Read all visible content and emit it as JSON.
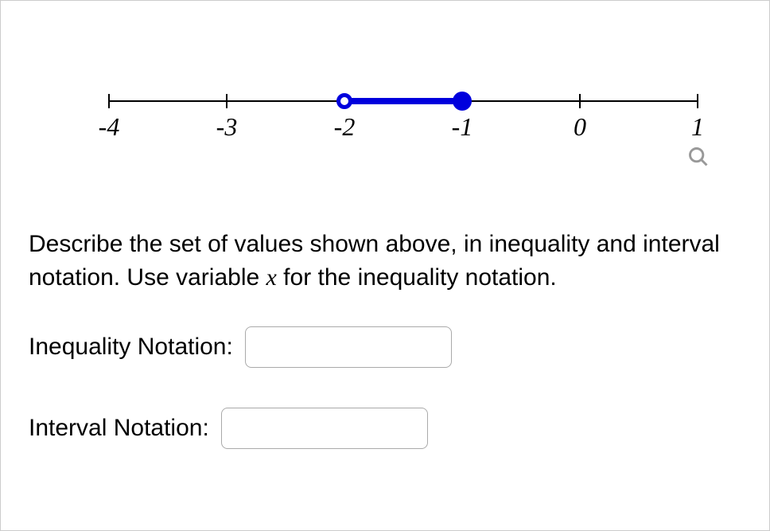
{
  "chart_data": {
    "type": "number_line",
    "xmin": -4,
    "xmax": 1,
    "ticks": [
      -4,
      -3,
      -2,
      -1,
      0,
      1
    ],
    "interval": {
      "start": -2,
      "start_inclusive": false,
      "end": -1,
      "end_inclusive": true
    }
  },
  "tick_labels": {
    "m4": "-4",
    "m3": "-3",
    "m2": "-2",
    "m1": "-1",
    "z0": "0",
    "p1": "1"
  },
  "question": {
    "part1": "Describe the set of values shown above, in inequality and interval notation. Use variable ",
    "variable": "x",
    "part2": " for the inequality notation."
  },
  "labels": {
    "inequality": "Inequality Notation:",
    "interval": "Interval Notation:"
  },
  "inputs": {
    "inequality_value": "",
    "interval_value": ""
  }
}
